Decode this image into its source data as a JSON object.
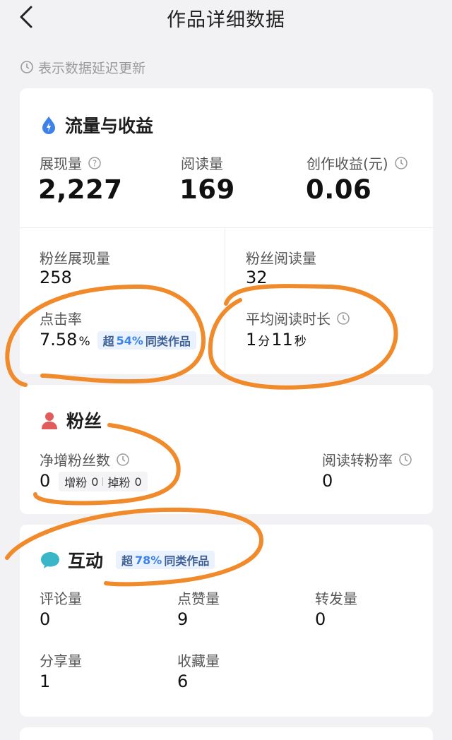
{
  "header": {
    "title": "作品详细数据"
  },
  "delay_note": "表示数据延迟更新",
  "traffic": {
    "title": "流量与收益",
    "impressions": {
      "label": "展现量",
      "value": "2,227"
    },
    "reads": {
      "label": "阅读量",
      "value": "169"
    },
    "earnings": {
      "label": "创作收益(元)",
      "value": "0.06"
    },
    "fan_impressions": {
      "label": "粉丝展现量",
      "value": "258"
    },
    "fan_reads": {
      "label": "粉丝阅读量",
      "value": "32"
    },
    "ctr": {
      "label": "点击率",
      "value": "7.58",
      "unit": "%",
      "badge_prefix": "超",
      "badge_num": "54%",
      "badge_suffix": "同类作品"
    },
    "avg_read": {
      "label": "平均阅读时长",
      "min_value": "1",
      "min_unit": "分",
      "sec_value": "11",
      "sec_unit": "秒"
    }
  },
  "fans": {
    "title": "粉丝",
    "net_gain": {
      "label": "净增粉丝数",
      "value": "0",
      "gain_label": "增粉",
      "gain_value": "0",
      "loss_label": "掉粉",
      "loss_value": "0"
    },
    "conversion": {
      "label": "阅读转粉率",
      "value": "0"
    }
  },
  "interaction": {
    "title": "互动",
    "badge_prefix": "超",
    "badge_num": "78%",
    "badge_suffix": "同类作品",
    "comments": {
      "label": "评论量",
      "value": "0"
    },
    "likes": {
      "label": "点赞量",
      "value": "9"
    },
    "forwards": {
      "label": "转发量",
      "value": "0"
    },
    "shares": {
      "label": "分享量",
      "value": "1"
    },
    "favorites": {
      "label": "收藏量",
      "value": "6"
    }
  },
  "colors": {
    "annotation": "#f08a2a",
    "accent": "#3c82e8",
    "fans_icon": "#e25c5c",
    "interaction_icon": "#3bb6c9"
  }
}
